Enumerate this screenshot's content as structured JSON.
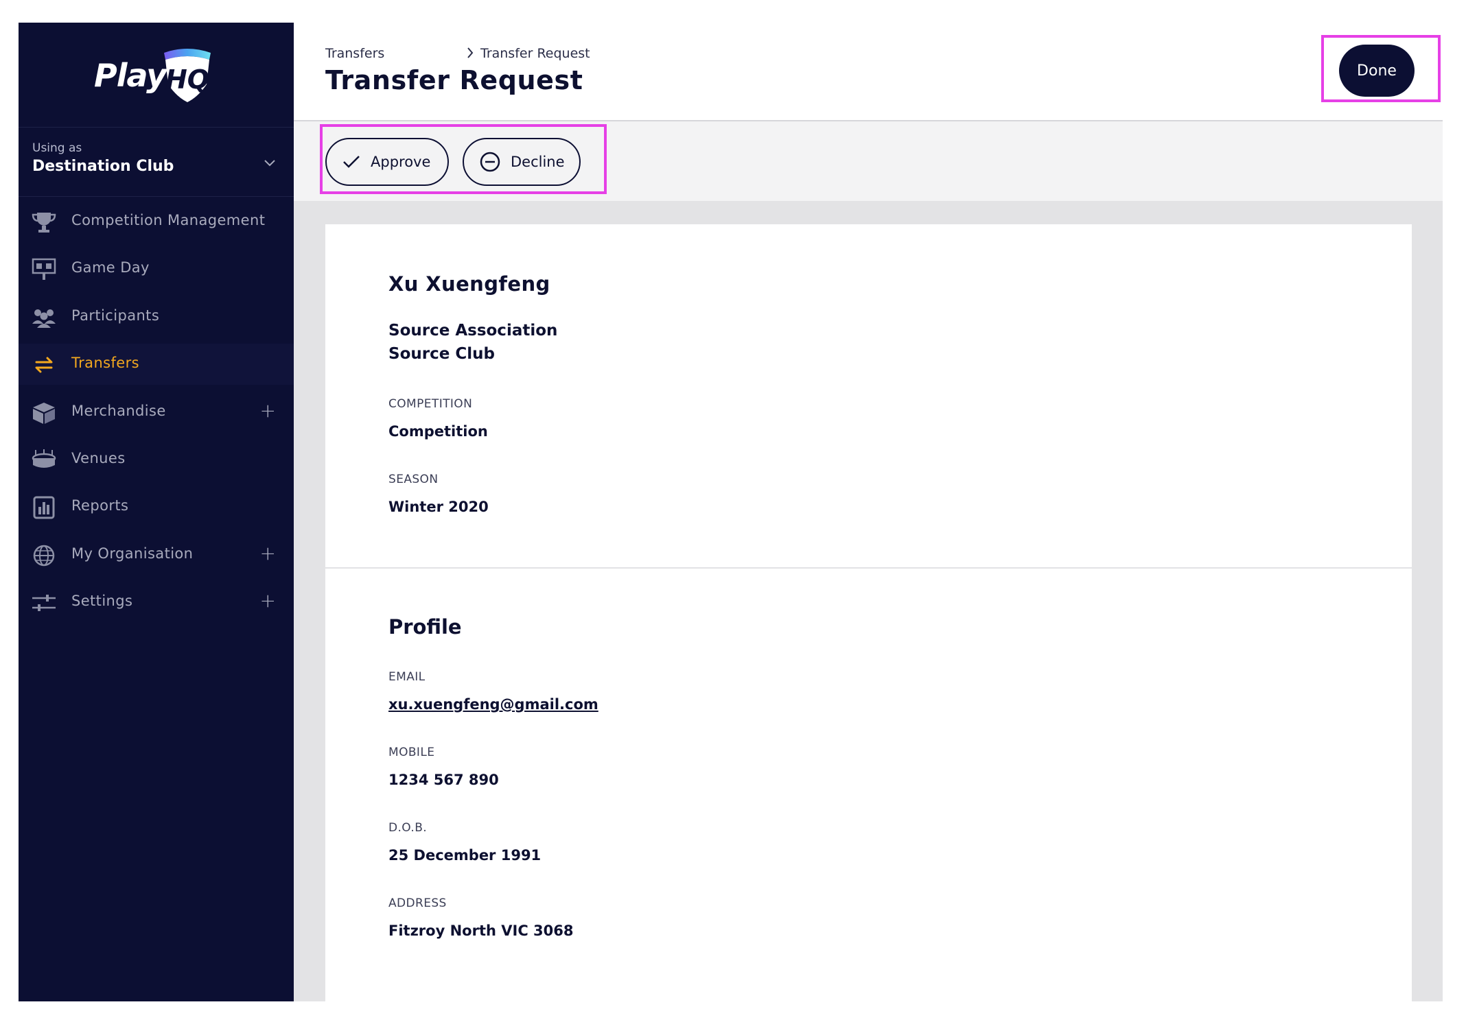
{
  "brand": {
    "logo_text": "Play",
    "logo_mark": "HQ"
  },
  "using_as": {
    "label": "Using as",
    "value": "Destination Club"
  },
  "nav": [
    {
      "label": "Competition Management",
      "icon": "trophy-icon",
      "expandable": false,
      "active": false
    },
    {
      "label": "Game Day",
      "icon": "scoreboard-icon",
      "expandable": false,
      "active": false
    },
    {
      "label": "Participants",
      "icon": "people-icon",
      "expandable": false,
      "active": false
    },
    {
      "label": "Transfers",
      "icon": "transfer-arrows-icon",
      "expandable": false,
      "active": true
    },
    {
      "label": "Merchandise",
      "icon": "box-icon",
      "expandable": true,
      "active": false
    },
    {
      "label": "Venues",
      "icon": "stadium-icon",
      "expandable": false,
      "active": false
    },
    {
      "label": "Reports",
      "icon": "report-icon",
      "expandable": false,
      "active": false
    },
    {
      "label": "My Organisation",
      "icon": "globe-icon",
      "expandable": true,
      "active": false
    },
    {
      "label": "Settings",
      "icon": "sliders-icon",
      "expandable": true,
      "active": false
    }
  ],
  "header": {
    "breadcrumb": [
      "Transfers",
      "Transfer Request"
    ],
    "title": "Transfer Request",
    "done_label": "Done"
  },
  "actions": {
    "approve_label": "Approve",
    "decline_label": "Decline"
  },
  "transfer": {
    "name": "Xu Xuengfeng",
    "source_association": "Source Association",
    "source_club": "Source Club",
    "competition_label": "COMPETITION",
    "competition_value": "Competition",
    "season_label": "SEASON",
    "season_value": "Winter 2020"
  },
  "profile": {
    "title": "Profile",
    "email_label": "EMAIL",
    "email_value": "xu.xuengfeng@gmail.com",
    "mobile_label": "MOBILE",
    "mobile_value": "1234 567 890",
    "dob_label": "D.O.B.",
    "dob_value": "25 December 1991",
    "address_label": "ADDRESS",
    "address_value": "Fitzroy North VIC 3068"
  },
  "colors": {
    "sidebar_bg": "#0c0f33",
    "accent_active": "#f3a81f",
    "highlight_frame": "#e640e6"
  }
}
